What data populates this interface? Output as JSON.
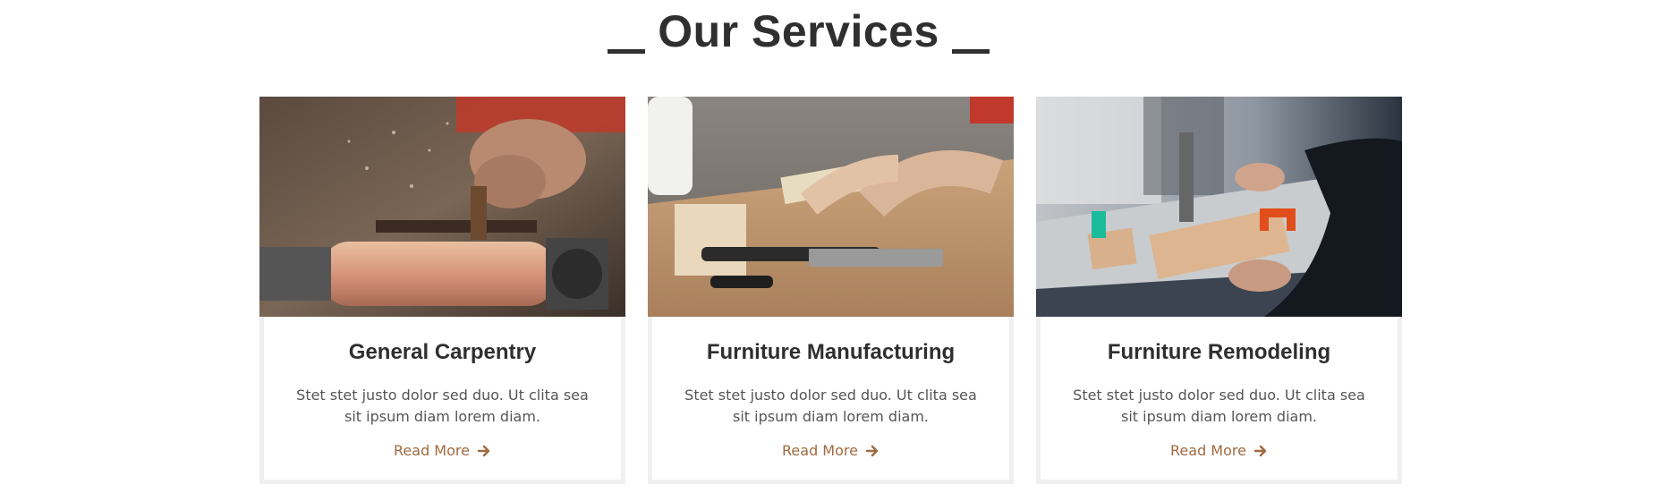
{
  "section": {
    "title": "Our Services"
  },
  "cards": [
    {
      "title": "General Carpentry",
      "description": "Stet stet justo dolor sed duo. Ut clita sea sit ipsum diam lorem diam.",
      "link": "Read More",
      "image": "wood-lathe-photo"
    },
    {
      "title": "Furniture Manufacturing",
      "description": "Stet stet justo dolor sed duo. Ut clita sea sit ipsum diam lorem diam.",
      "link": "Read More",
      "image": "workbench-clamp-photo"
    },
    {
      "title": "Furniture Remodeling",
      "description": "Stet stet justo dolor sed duo. Ut clita sea sit ipsum diam lorem diam.",
      "link": "Read More",
      "image": "table-saw-photo"
    }
  ],
  "colors": {
    "heading": "#2f2f2f",
    "accent": "#a06a40",
    "card_border": "#f0f0f0"
  },
  "icons": {
    "link": "arrow-right-icon"
  }
}
